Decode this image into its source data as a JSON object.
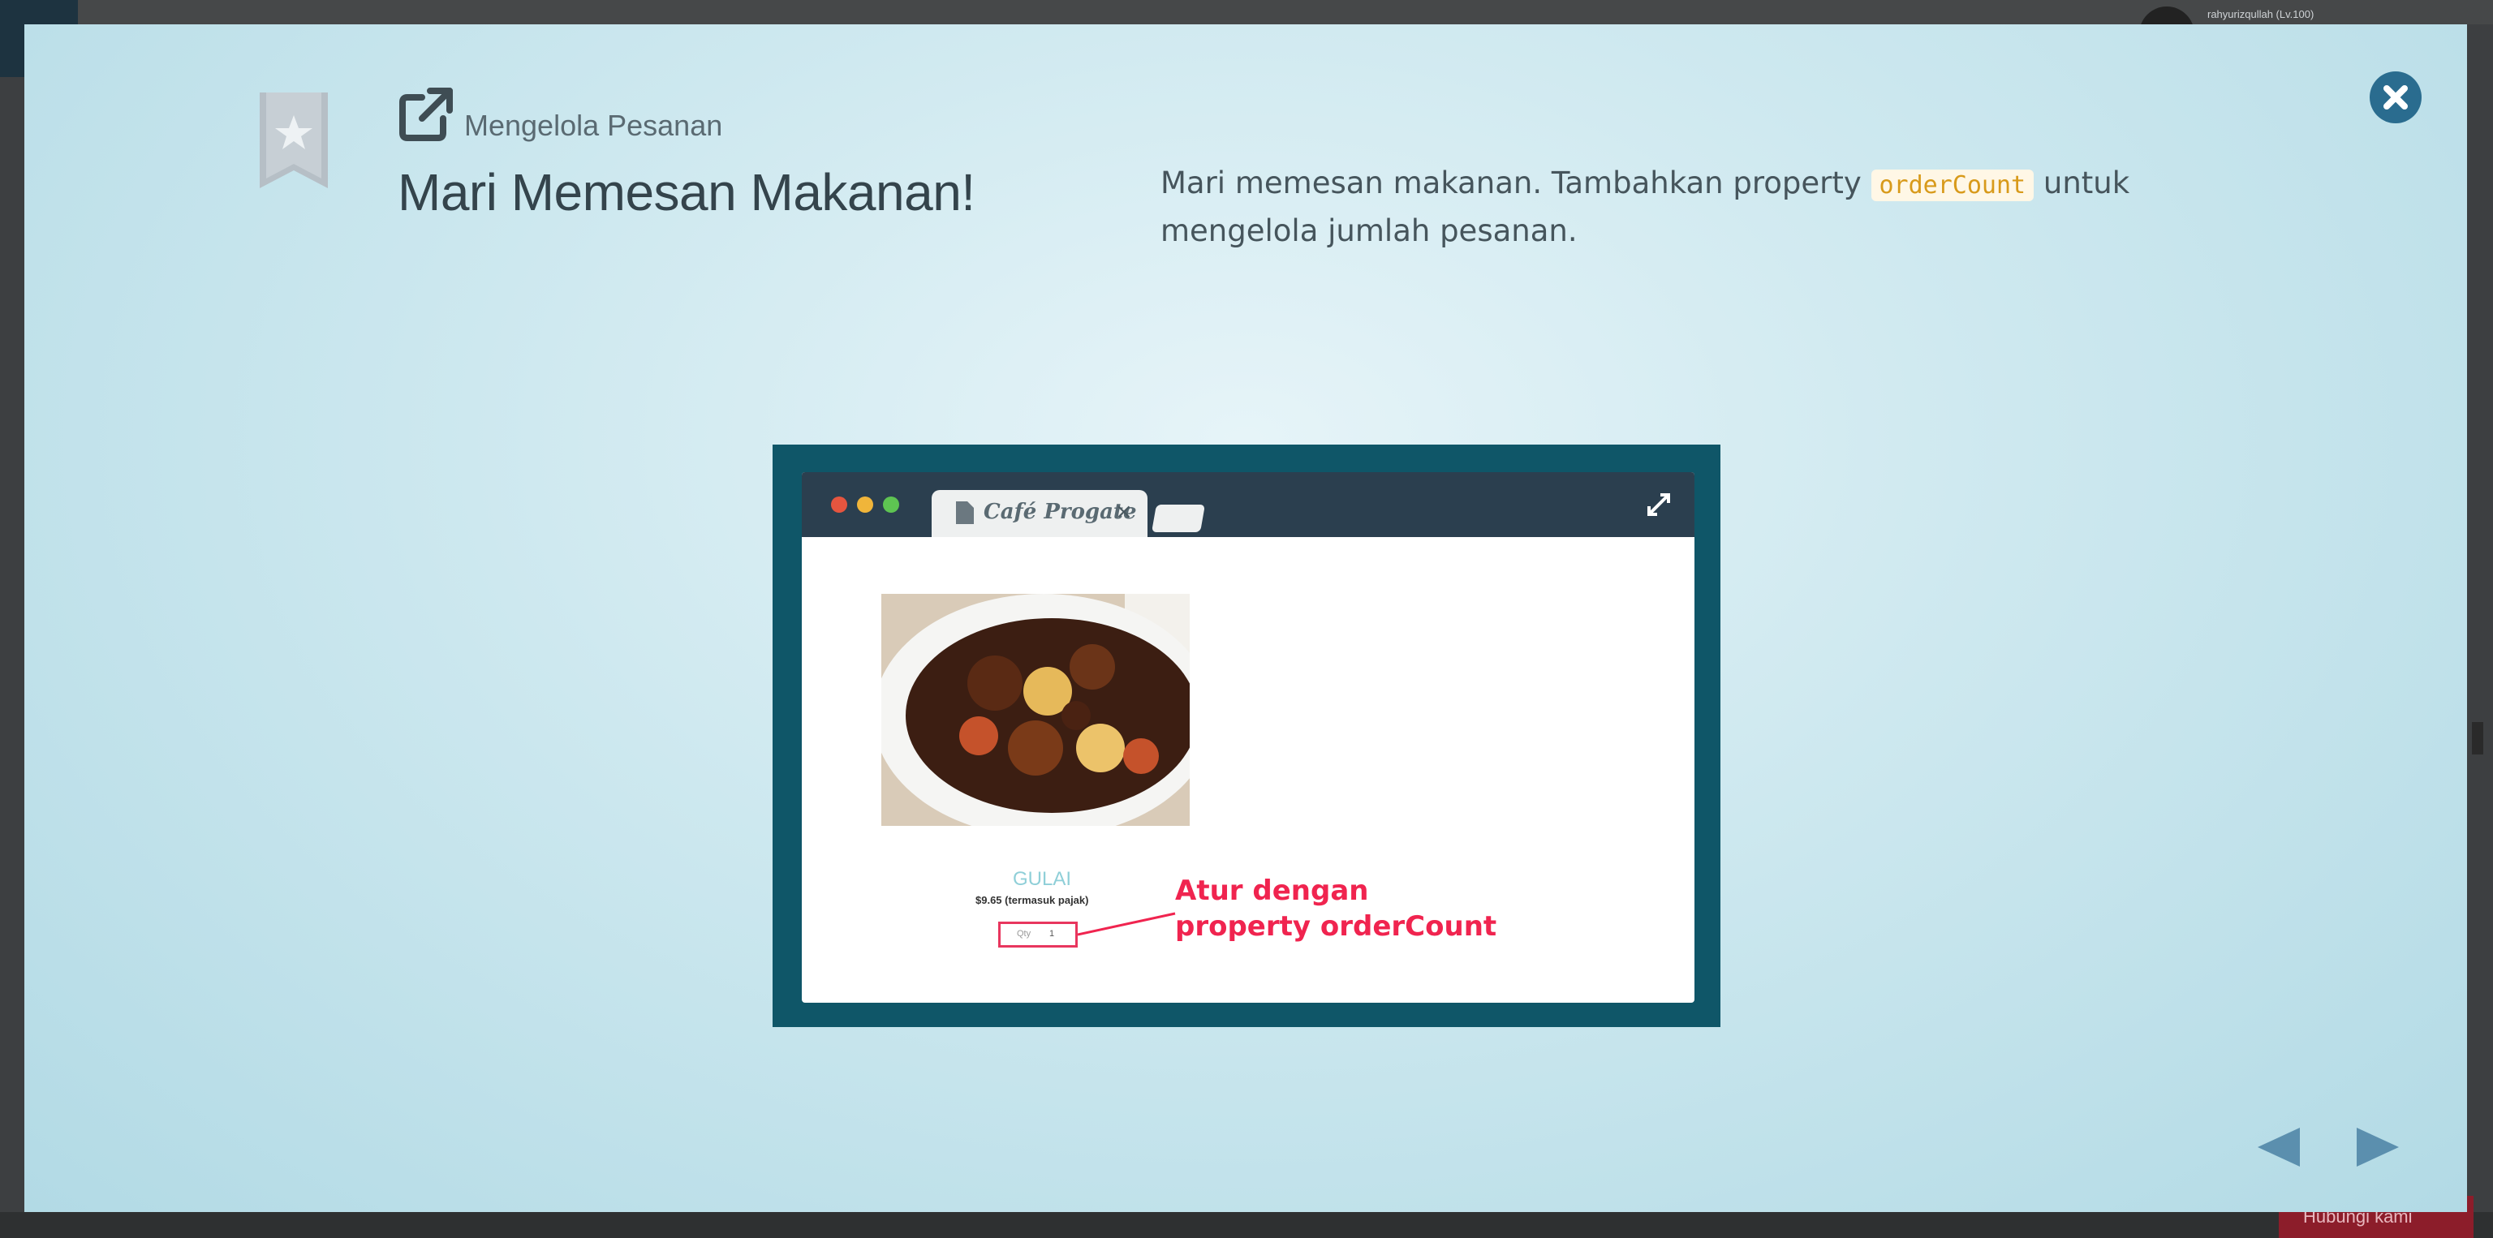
{
  "background_page": {
    "username": "rahyurizqullah (Lv.100)",
    "help_button": "Hubungi kami"
  },
  "modal": {
    "section_label": "Mengelola Pesanan",
    "title": "Mari Memesan Makanan!",
    "description_before": "Mari memesan makanan. Tambahkan property ",
    "description_code": "orderCount",
    "description_after": " untuk mengelola jumlah pesanan."
  },
  "illustration": {
    "tab_title": "Café Progate",
    "tab_close": "×",
    "food_name": "GULAI",
    "food_price": "$9.65 (termasuk pajak)",
    "qty_label": "Qty",
    "qty_value": "1",
    "callout": "Atur dengan\nproperty orderCount"
  },
  "icons": {
    "close": "close-circle-icon",
    "bookmark": "bookmark-star-icon",
    "external": "external-link-icon",
    "prev": "triangle-left-icon",
    "next": "triangle-right-icon",
    "expand": "expand-icon"
  },
  "colors": {
    "accent": "#2a6c8f",
    "callout": "#f0244f",
    "code_text": "#d89a1a",
    "illustration_frame": "#0f5668",
    "arrow": "#5b8fae"
  }
}
